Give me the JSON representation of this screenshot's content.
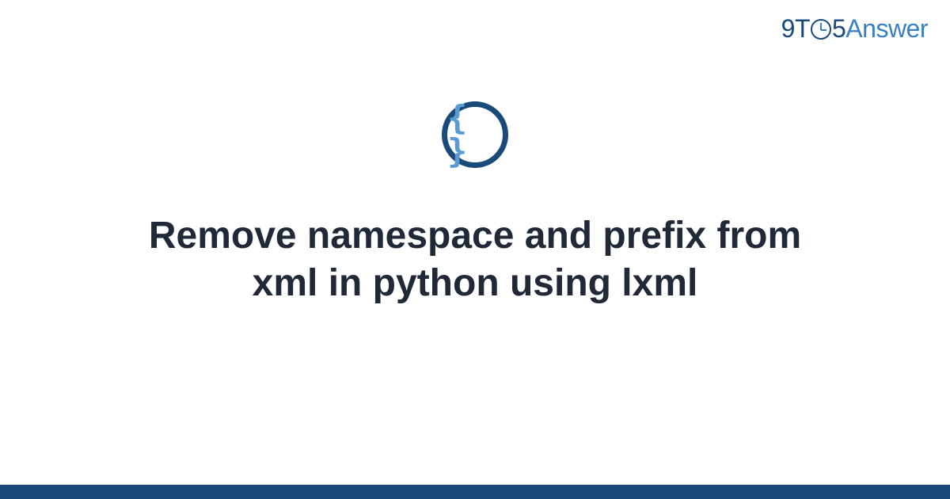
{
  "logo": {
    "nine": "9",
    "t": "T",
    "five": "5",
    "answer": "Answer"
  },
  "icon": {
    "braces": "{ }"
  },
  "title": "Remove namespace and prefix from xml in python using lxml"
}
